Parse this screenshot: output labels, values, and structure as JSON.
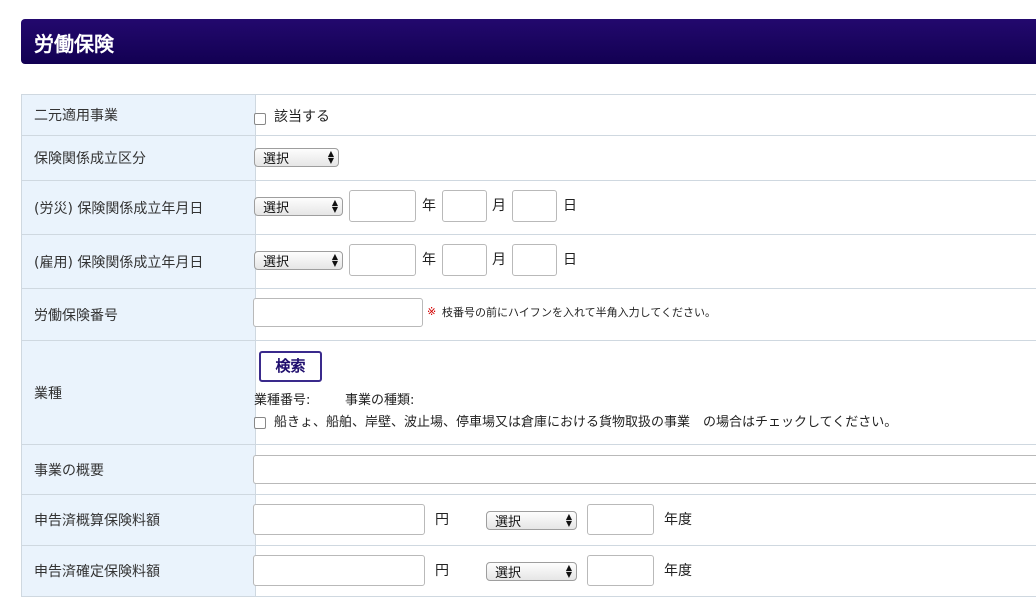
{
  "section_title": "労働保険",
  "rows": {
    "nigen": {
      "label": "二元適用事業",
      "checkbox_label": "該当する"
    },
    "kubun": {
      "label": "保険関係成立区分",
      "select": "選択"
    },
    "rousai": {
      "label": "(労災) 保険関係成立年月日",
      "select": "選択"
    },
    "koyou": {
      "label": "(雇用) 保険関係成立年月日",
      "select": "選択"
    },
    "bango": {
      "label": "労働保険番号",
      "note_mark": "※",
      "note": "枝番号の前にハイフンを入れて半角入力してください。"
    },
    "gyoshu": {
      "label": "業種",
      "search_button": "検索",
      "gyoshu_bango_label": "業種番号:",
      "jigyo_shurui_label": "事業の種類:",
      "checkbox_label": "船きょ、船舶、岸壁、波止場、停車場又は倉庫における貨物取扱の事業　の場合はチェックしてください。"
    },
    "gaiyou": {
      "label": "事業の概要"
    },
    "gaisan": {
      "label": "申告済概算保険料額",
      "select": "選択"
    },
    "kakutei": {
      "label": "申告済確定保険料額",
      "select": "選択"
    }
  },
  "units": {
    "year": "年",
    "month": "月",
    "day": "日",
    "yen": "円",
    "nendo": "年度"
  }
}
